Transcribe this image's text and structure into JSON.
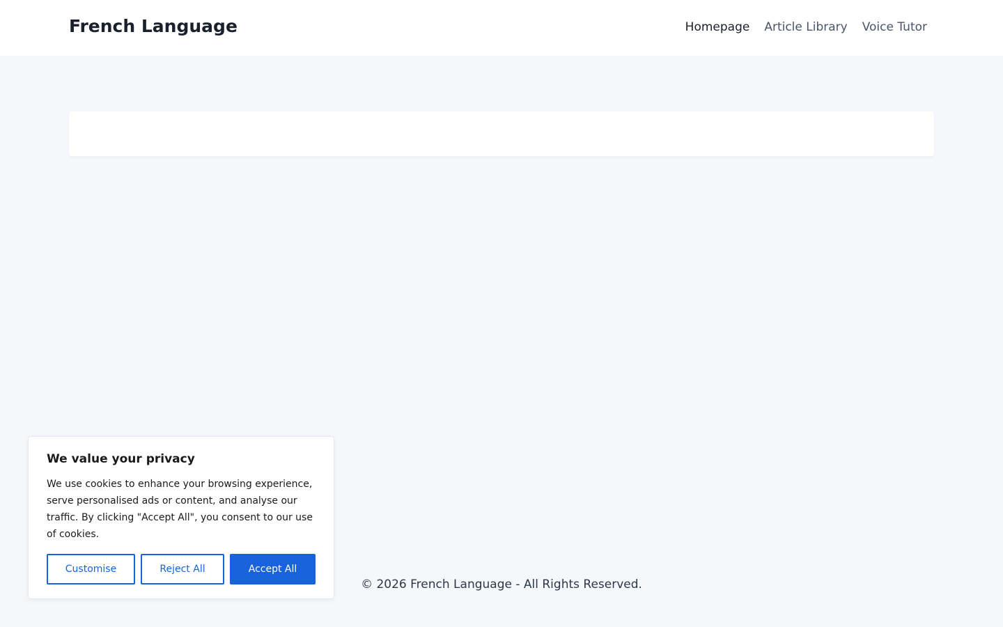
{
  "header": {
    "site_title": "French Language",
    "nav": [
      {
        "label": "Homepage",
        "active": true
      },
      {
        "label": "Article Library",
        "active": false
      },
      {
        "label": "Voice Tutor",
        "active": false
      }
    ]
  },
  "footer": {
    "copyright": "© 2026 French Language - All Rights Reserved."
  },
  "cookie_banner": {
    "title": "We value your privacy",
    "text": "We use cookies to enhance your browsing experience, serve personalised ads or content, and analyse our traffic. By clicking \"Accept All\", you consent to our use of cookies.",
    "customise_label": "Customise",
    "reject_label": "Reject All",
    "accept_label": "Accept All"
  },
  "colors": {
    "accent": "#1863dc",
    "page_background": "#f5f8fb",
    "header_background": "#ffffff"
  }
}
